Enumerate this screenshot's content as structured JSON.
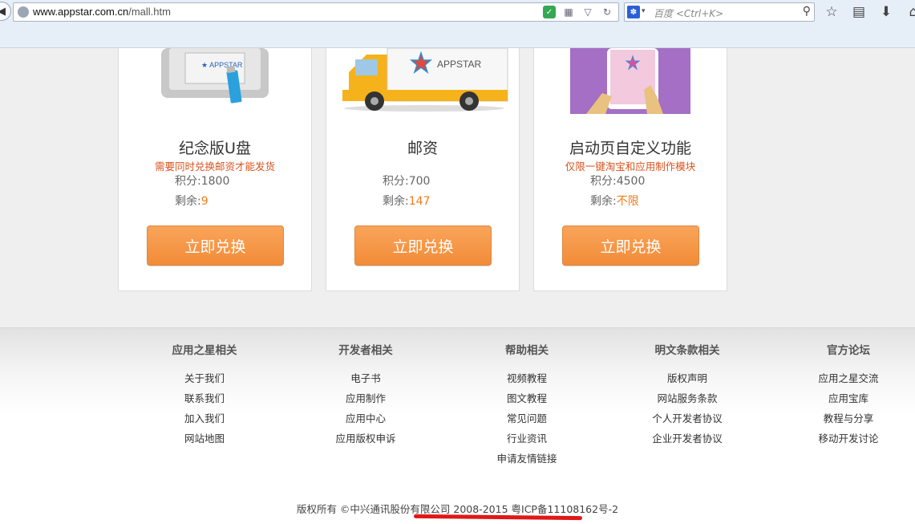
{
  "browser": {
    "url_host": "www.appstar.com.cn",
    "url_path": "/mall.htm",
    "search_placeholder": "百度 <Ctrl+K>"
  },
  "products": [
    {
      "title": "纪念版U盘",
      "note": "需要同时兑换邮资才能发货",
      "points": "积分:1800",
      "remain_label": "剩余:",
      "remain_value": "9",
      "button": "立即兑换"
    },
    {
      "title": "邮资",
      "note": "",
      "points": "积分:700",
      "remain_label": "剩余:",
      "remain_value": "147",
      "button": "立即兑换"
    },
    {
      "title": "启动页自定义功能",
      "note": "仅限一键淘宝和应用制作模块",
      "points": "积分:4500",
      "remain_label": "剩余:",
      "remain_value": "不限",
      "button": "立即兑换"
    }
  ],
  "truck_brand": "APPSTAR",
  "footer": {
    "columns": [
      {
        "title": "应用之星相关",
        "links": [
          "关于我们",
          "联系我们",
          "加入我们",
          "网站地图"
        ]
      },
      {
        "title": "开发者相关",
        "links": [
          "电子书",
          "应用制作",
          "应用中心",
          "应用版权申诉"
        ]
      },
      {
        "title": "帮助相关",
        "links": [
          "视频教程",
          "图文教程",
          "常见问题",
          "行业资讯",
          "申请友情链接"
        ]
      },
      {
        "title": "明文条款相关",
        "links": [
          "版权声明",
          "网站服务条款",
          "个人开发者协议",
          "企业开发者协议"
        ]
      },
      {
        "title": "官方论坛",
        "links": [
          "应用之星交流",
          "应用宝库",
          "教程与分享",
          "移动开发讨论"
        ]
      }
    ],
    "copyright": "版权所有 ©中兴通讯股份有限公司 2008-2015 粤ICP备11108162号-2"
  },
  "colors": {
    "accent_orange": "#f28c38",
    "note_red": "#d9531e",
    "remain_orange": "#f07c1c",
    "annotation_red": "#e01818"
  }
}
